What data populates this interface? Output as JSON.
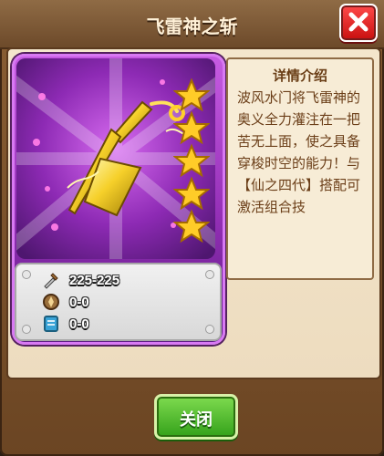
{
  "window": {
    "title": "飞雷神之斩",
    "close_icon": "close-x-icon"
  },
  "item": {
    "name": "飞雷神之斩",
    "stars": 5,
    "art_icon": "kunai-icon",
    "stats": [
      {
        "icon": "sword-icon",
        "value": "225-225"
      },
      {
        "icon": "shield-icon",
        "value": "0-0"
      },
      {
        "icon": "tablet-icon",
        "value": "0-0"
      }
    ]
  },
  "details": {
    "heading": "详情介绍",
    "text": "波风水门将飞雷神的奥义全力灌注在一把苦无上面，使之具备穿梭时空的能力！与【仙之四代】搭配可激活组合技"
  },
  "buttons": {
    "close_label": "关闭"
  },
  "colors": {
    "card_purple": "#9530b7",
    "star_gold": "#ffcc28",
    "close_green": "#34a11a",
    "close_red": "#d21f1f"
  }
}
